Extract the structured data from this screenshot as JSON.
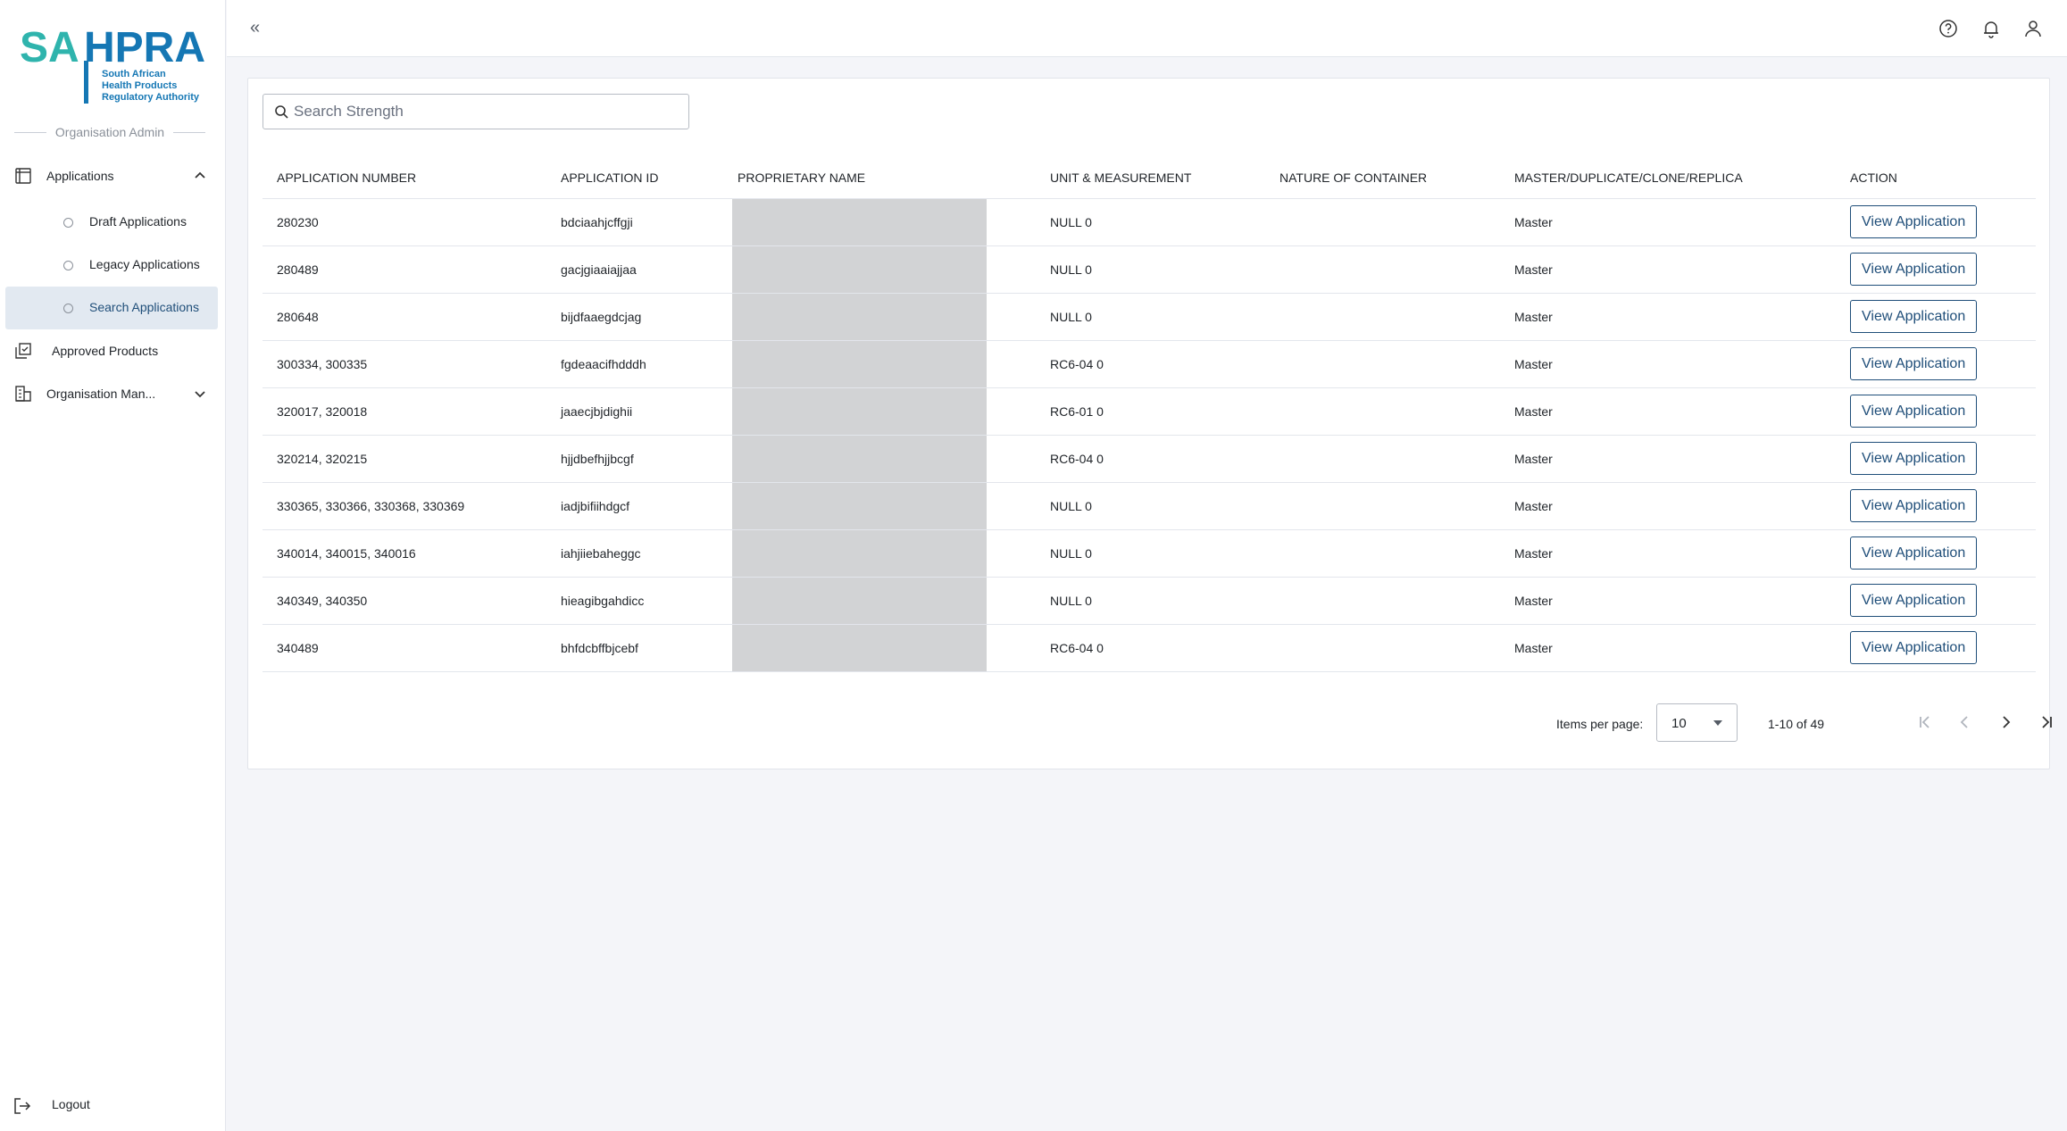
{
  "logo": {
    "left": "SA",
    "right": "HPRA",
    "tagline": "South African\nHealth Products\nRegulatory Authority"
  },
  "sidebar": {
    "section_label": "Organisation Admin",
    "items": [
      {
        "label": "Applications",
        "icon": "document-icon",
        "expanded": true
      },
      {
        "label": "Draft Applications",
        "icon": "circle-icon"
      },
      {
        "label": "Legacy Applications",
        "icon": "circle-icon"
      },
      {
        "label": "Search Applications",
        "icon": "circle-icon",
        "active": true
      },
      {
        "label": "Approved Products",
        "icon": "checked-copy-icon"
      },
      {
        "label": "Organisation Man...",
        "icon": "building-icon",
        "expanded": false
      }
    ],
    "logout_label": "Logout"
  },
  "topbar": {
    "collapse_glyph": "«",
    "icons": [
      "help-icon",
      "bell-icon",
      "user-icon"
    ]
  },
  "search": {
    "placeholder": "Search Strength",
    "value": ""
  },
  "table": {
    "headers": [
      "APPLICATION NUMBER",
      "APPLICATION ID",
      "PROPRIETARY NAME",
      "UNIT & MEASUREMENT",
      "NATURE OF CONTAINER",
      "MASTER/DUPLICATE/CLONE/REPLICA",
      "ACTION"
    ],
    "action_label": "View Application",
    "rows": [
      {
        "number": "280230",
        "id": "bdciaahjcffgji",
        "unit": "NULL 0",
        "nature": "",
        "type": "Master"
      },
      {
        "number": "280489",
        "id": "gacjgiaaiajjaa",
        "unit": "NULL 0",
        "nature": "",
        "type": "Master"
      },
      {
        "number": "280648",
        "id": "bijdfaaegdcjag",
        "unit": "NULL 0",
        "nature": "",
        "type": "Master"
      },
      {
        "number": "300334, 300335",
        "id": "fgdeaacifhdddh",
        "unit": "RC6-04 0",
        "nature": "",
        "type": "Master"
      },
      {
        "number": "320017, 320018",
        "id": "jaaecjbjdighii",
        "unit": "RC6-01 0",
        "nature": "",
        "type": "Master"
      },
      {
        "number": "320214, 320215",
        "id": "hjjdbefhjjbcgf",
        "unit": "RC6-04 0",
        "nature": "",
        "type": "Master"
      },
      {
        "number": "330365, 330366, 330368, 330369",
        "id": "iadjbifiihdgcf",
        "unit": "NULL 0",
        "nature": "",
        "type": "Master"
      },
      {
        "number": "340014, 340015, 340016",
        "id": "iahjiiebaheggc",
        "unit": "NULL 0",
        "nature": "",
        "type": "Master"
      },
      {
        "number": "340349, 340350",
        "id": "hieagibgahdicc",
        "unit": "NULL 0",
        "nature": "",
        "type": "Master"
      },
      {
        "number": "340489",
        "id": "bhfdcbffbjcebf",
        "unit": "RC6-04 0",
        "nature": "",
        "type": "Master"
      }
    ]
  },
  "pagination": {
    "items_per_page_label": "Items per page:",
    "items_per_page_value": "10",
    "range_label": "1-10 of 49"
  },
  "colors": {
    "primary": "#1f4e79",
    "logo_teal": "#2fb4ad",
    "logo_blue": "#1577b4",
    "active_bg": "#e2e9f1",
    "page_bg": "#f4f5f9"
  }
}
